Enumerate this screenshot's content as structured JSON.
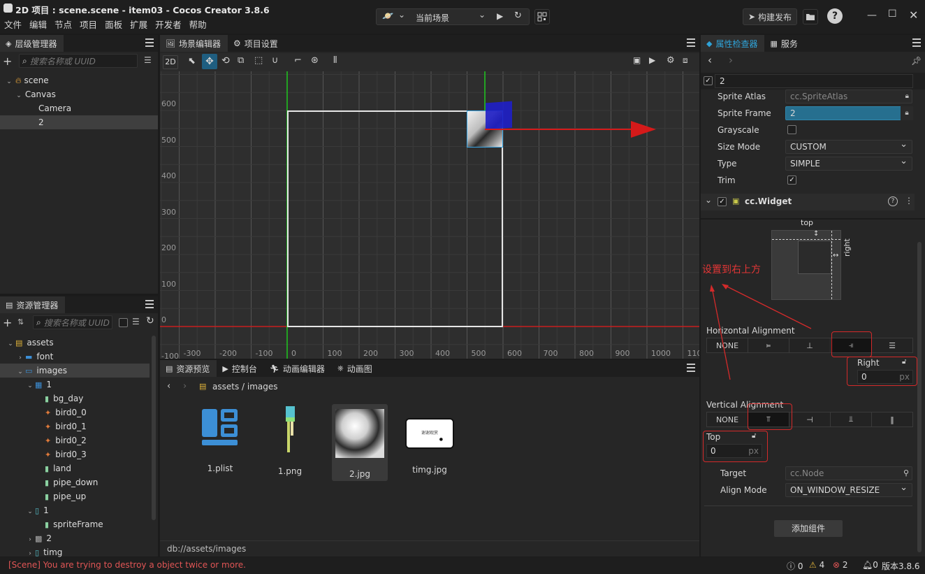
{
  "window": {
    "title": "2D 项目 : scene.scene - item03 - Cocos Creator 3.8.6",
    "menu": [
      "文件",
      "编辑",
      "节点",
      "项目",
      "面板",
      "扩展",
      "开发者",
      "帮助"
    ],
    "scene_select": "当前场景",
    "build_button": "构建发布"
  },
  "hierarchy": {
    "tab": "层级管理器",
    "search_placeholder": "搜索名称或 UUID",
    "nodes": [
      {
        "label": "scene",
        "depth": 0
      },
      {
        "label": "Canvas",
        "depth": 1
      },
      {
        "label": "Camera",
        "depth": 2
      },
      {
        "label": "2",
        "depth": 2,
        "selected": true
      }
    ]
  },
  "assets": {
    "tab": "资源管理器",
    "search_placeholder": "搜索名称或 UUID",
    "items": [
      {
        "label": "assets",
        "depth": 0,
        "icon": "db-icon",
        "open": true
      },
      {
        "label": "font",
        "depth": 1,
        "icon": "folder-icon",
        "open": false
      },
      {
        "label": "images",
        "depth": 1,
        "icon": "folder-open-icon",
        "open": true,
        "selected": true
      },
      {
        "label": "1",
        "depth": 2,
        "icon": "plist-icon",
        "open": true
      },
      {
        "label": "bg_day",
        "depth": 3,
        "icon": "sprite-icon"
      },
      {
        "label": "bird0_0",
        "depth": 3,
        "icon": "bird-icon"
      },
      {
        "label": "bird0_1",
        "depth": 3,
        "icon": "bird-icon"
      },
      {
        "label": "bird0_2",
        "depth": 3,
        "icon": "bird-icon"
      },
      {
        "label": "bird0_3",
        "depth": 3,
        "icon": "bird-icon"
      },
      {
        "label": "land",
        "depth": 3,
        "icon": "sprite-icon"
      },
      {
        "label": "pipe_down",
        "depth": 3,
        "icon": "sprite-icon"
      },
      {
        "label": "pipe_up",
        "depth": 3,
        "icon": "sprite-icon"
      },
      {
        "label": "1",
        "depth": 2,
        "icon": "image-icon",
        "open": true
      },
      {
        "label": "spriteFrame",
        "depth": 3,
        "icon": "sprite-icon"
      },
      {
        "label": "2",
        "depth": 2,
        "icon": "photo-icon",
        "open": false
      },
      {
        "label": "timg",
        "depth": 2,
        "icon": "image-icon",
        "open": false
      }
    ]
  },
  "scene_editor": {
    "tabs": [
      "场景编辑器",
      "项目设置"
    ],
    "mode_2d": "2D",
    "x_labels": [
      "-300",
      "-200",
      "-100",
      "0",
      "100",
      "200",
      "300",
      "400",
      "500",
      "600",
      "700",
      "800",
      "900",
      "1000",
      "110"
    ],
    "y_labels": [
      "600",
      "500",
      "400",
      "300",
      "200",
      "100",
      "0",
      "-100"
    ]
  },
  "bottom_panel": {
    "tabs": [
      "资源预览",
      "控制台",
      "动画编辑器",
      "动画图"
    ],
    "breadcrumb": [
      "assets",
      "images"
    ],
    "assets": [
      {
        "label": "1.plist",
        "icon": "plist-large-icon"
      },
      {
        "label": "1.png",
        "icon": "png-thumb-icon"
      },
      {
        "label": "2.jpg",
        "icon": "photo-thumb-icon",
        "selected": true
      },
      {
        "label": "timg.jpg",
        "icon": "timg-thumb-icon"
      }
    ],
    "thumb_caption": "谢谢观赏",
    "path": "db://assets/images"
  },
  "inspector": {
    "tabs": [
      "属性检查器",
      "服务"
    ],
    "node_name": "2",
    "sprite": {
      "atlas_label": "Sprite Atlas",
      "atlas_value": "cc.SpriteAtlas",
      "frame_label": "Sprite Frame",
      "frame_value": "2",
      "grayscale_label": "Grayscale",
      "sizemode_label": "Size Mode",
      "sizemode_value": "CUSTOM",
      "type_label": "Type",
      "type_value": "SIMPLE",
      "trim_label": "Trim"
    },
    "widget": {
      "title": "cc.Widget",
      "diagram_top": "top",
      "diagram_right": "right",
      "h_align_label": "Horizontal Alignment",
      "h_none": "NONE",
      "right_label": "Right",
      "right_value": "0",
      "right_unit": "px",
      "v_align_label": "Vertical Alignment",
      "v_none": "NONE",
      "top_label": "Top",
      "top_value": "0",
      "top_unit": "px",
      "target_label": "Target",
      "target_value": "cc.Node",
      "align_mode_label": "Align Mode",
      "align_mode_value": "ON_WINDOW_RESIZE"
    },
    "add_component": "添加组件",
    "annotation": "设置到右上方"
  },
  "status": {
    "message": "[Scene] You are trying to destroy a object twice or more.",
    "info_count": "0",
    "warn_count": "4",
    "error_count": "2",
    "notify_count": "0",
    "version": "版本3.8.6"
  },
  "colors": {
    "accent": "#2fa3d8",
    "error_text": "#e05555",
    "annotation_red": "#d42a2a"
  }
}
